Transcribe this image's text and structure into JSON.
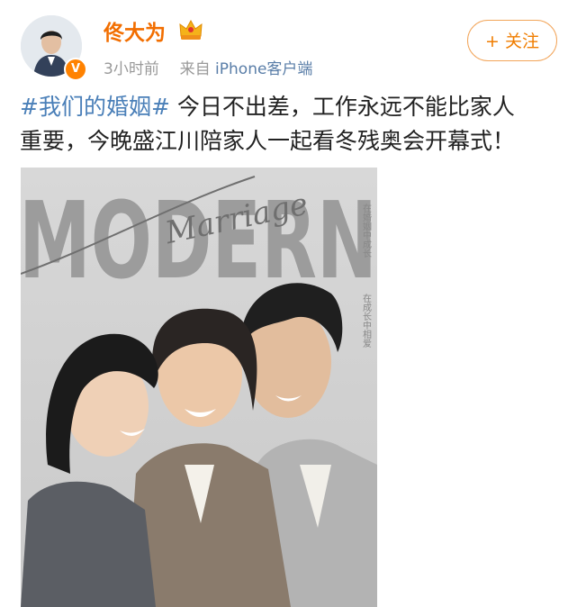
{
  "post": {
    "username": "佟大为",
    "time": "3小时前",
    "source_prefix": "来自",
    "source": "iPhone客户端",
    "follow_label": "+ 关注",
    "hashtag": "#我们的婚姻#",
    "body_line1": "今日不出差，工作永远不能比家人",
    "body_line2": "重要，今晚盛江川陪家人一起看冬残奥会开幕式！"
  },
  "poster": {
    "title": "MODERN",
    "script": "Marriage",
    "side_text_1": "在婚姻中成长",
    "side_text_2": "在成长中相爱"
  },
  "icons": {
    "verified": "verified-v-icon",
    "crown": "crown-vip-icon"
  },
  "colors": {
    "username": "#f26e00",
    "hashtag": "#4a7fb8",
    "follow": "#f07d00",
    "source": "#5a7ea8"
  }
}
